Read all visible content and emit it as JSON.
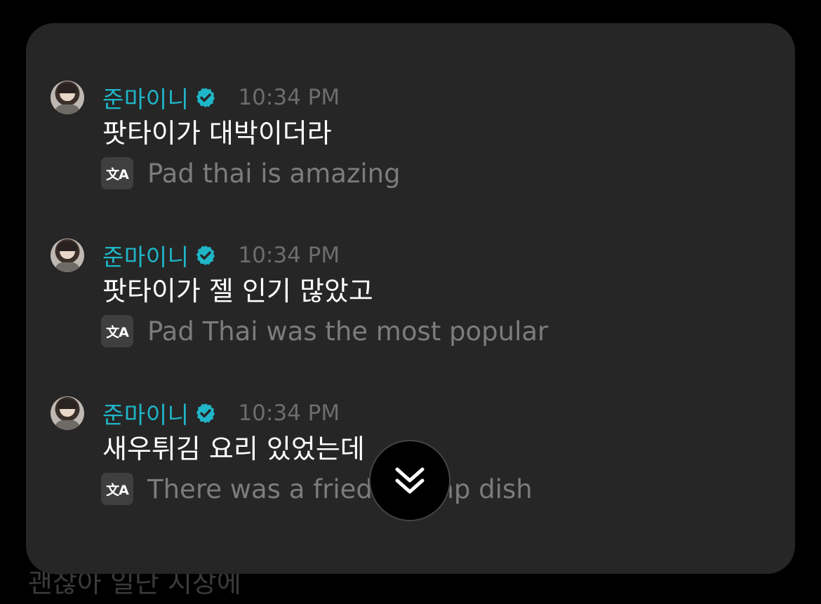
{
  "background": {
    "partial_text": "괜찮아 일단 시장에"
  },
  "messages": [
    {
      "author": "준마이니",
      "time": "10:34 PM",
      "text": "팟타이가 대박이더라",
      "translation": "Pad thai is amazing"
    },
    {
      "author": "준마이니",
      "time": "10:34 PM",
      "text": "팟타이가 젤 인기 많았고",
      "translation": "Pad Thai was the most popular"
    },
    {
      "author": "준마이니",
      "time": "10:34 PM",
      "text": "새우튀김 요리 있었는데",
      "translation": "There was a fried shrimp dish"
    }
  ],
  "icons": {
    "avatar": "avatar",
    "verified": "verified-badge-icon",
    "translate": "translate-icon",
    "scroll_down": "double-chevron-down-icon"
  },
  "translate_icon_glyph": "文A",
  "colors": {
    "card_bg": "#262626",
    "author": "#1fb6c8",
    "verified_badge": "#1fb6c8",
    "timestamp": "#6d6d6d",
    "message_text": "#ffffff",
    "translation_text": "#7c7c7c"
  }
}
